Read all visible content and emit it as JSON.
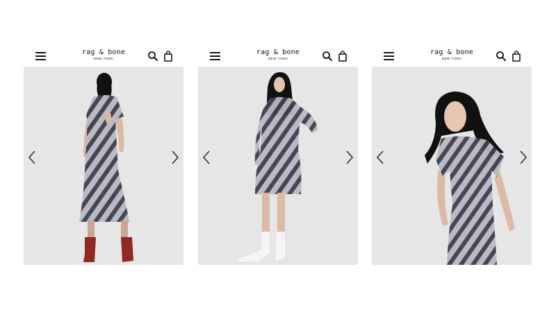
{
  "brand": {
    "name": "rag & bone",
    "sub": "NEW YORK"
  },
  "panels": [
    {
      "view": "back view",
      "boots": "red-ankle-boots"
    },
    {
      "view": "front view",
      "boots": "white-ankle-boots"
    },
    {
      "view": "close-up view",
      "boots": ""
    }
  ],
  "icons": {
    "menu": "hamburger-menu-icon",
    "search": "search-icon",
    "bag": "shopping-bag-icon",
    "prev": "chevron-left-icon",
    "next": "chevron-right-icon"
  },
  "colors": {
    "background": "#ffffff",
    "photo_bg": "#e6e6e6",
    "dress_dark": "#3d3f4e",
    "dress_light": "#b9b8c2",
    "boots_red": "#8e2a22",
    "boots_white": "#f2f2f2"
  }
}
